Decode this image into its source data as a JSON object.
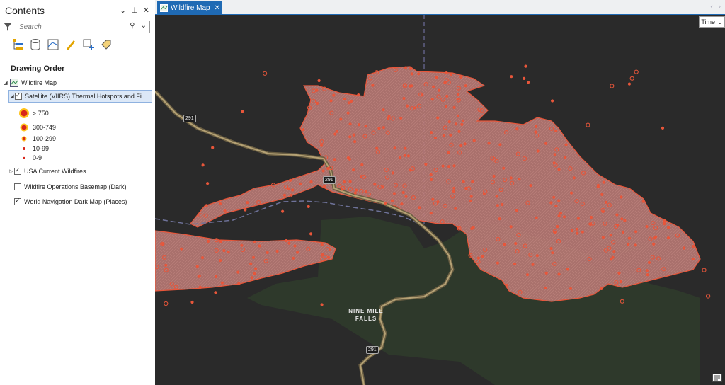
{
  "contents": {
    "title": "Contents",
    "search_placeholder": "Search",
    "drawing_order": "Drawing Order",
    "layers": {
      "map": "Wildfire Map",
      "viirs": "Satellite (VIIRS) Thermal Hotspots and Fi...",
      "usa_fires": "USA Current Wildfires",
      "basemap": "Wildfire Operations Basemap (Dark)",
      "nav_map": "World Navigation Dark Map (Places)"
    },
    "legend": [
      ">  750",
      "300-749",
      "100-299",
      "10-99",
      "0-9"
    ]
  },
  "map_view": {
    "tab_label": "Wildfire Map",
    "time_button": "Time",
    "place_label_1": "NINE MILE",
    "place_label_2": "FALLS",
    "highway": "291"
  },
  "colors": {
    "accent": "#1f6ab4",
    "hotspot": "#e8563a",
    "fire_fill": "#b77470"
  }
}
